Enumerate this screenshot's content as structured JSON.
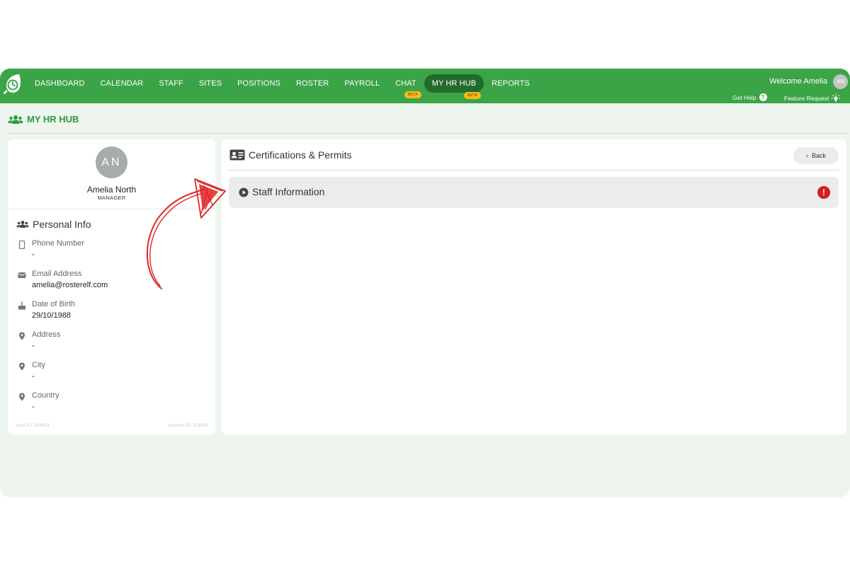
{
  "nav": {
    "items": [
      {
        "label": "DASHBOARD"
      },
      {
        "label": "CALENDAR"
      },
      {
        "label": "STAFF"
      },
      {
        "label": "SITES"
      },
      {
        "label": "POSITIONS"
      },
      {
        "label": "ROSTER"
      },
      {
        "label": "PAYROLL"
      },
      {
        "label": "CHAT",
        "badge": "BETA"
      },
      {
        "label": "MY HR HUB",
        "badge": "BETA",
        "active": true
      },
      {
        "label": "REPORTS"
      }
    ],
    "welcome": "Welcome Amelia",
    "avatar_initials": "AN",
    "get_help": "Get Help",
    "feature_request": "Feature Request"
  },
  "page": {
    "title": "MY HR HUB"
  },
  "profile": {
    "initials": "AN",
    "name": "Amelia North",
    "role": "MANAGER",
    "personal_info_heading": "Personal Info",
    "fields": [
      {
        "label": "Phone Number",
        "value": "-",
        "icon": "phone-icon"
      },
      {
        "label": "Email Address",
        "value": "amelia@rosterelf.com",
        "icon": "email-icon"
      },
      {
        "label": "Date of Birth",
        "value": "29/10/1988",
        "icon": "cake-icon"
      },
      {
        "label": "Address",
        "value": "-",
        "icon": "location-pin-icon"
      },
      {
        "label": "City",
        "value": "-",
        "icon": "location-pin-icon"
      },
      {
        "label": "Country",
        "value": "-",
        "icon": "location-pin-icon"
      }
    ],
    "user_id": "User ID: 204619",
    "account_id": "Account ID: 201805"
  },
  "certifications": {
    "title": "Certifications & Permits",
    "back_label": "Back",
    "section_label": "Staff Information",
    "alert_symbol": "!"
  },
  "colors": {
    "brand_green": "#3aa447",
    "active_nav": "#236b2d",
    "beta_badge": "#f6b91c",
    "alert_red": "#d21f1f",
    "annotation_arrow": "#e02525"
  }
}
